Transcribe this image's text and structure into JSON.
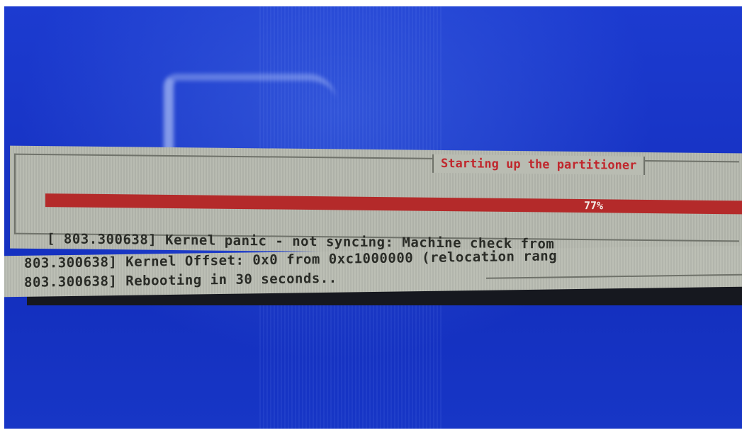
{
  "dialog": {
    "title": "Starting up the partitioner"
  },
  "progress": {
    "label": "77%",
    "value": 77
  },
  "console": {
    "lines": [
      "[   803.300638] Kernel panic - not syncing: Machine check from",
      "803.300638] Kernel Offset: 0x0 from 0xc1000000 (relocation rang",
      "803.300638] Rebooting in 30 seconds.."
    ]
  },
  "colors": {
    "screen_background": "#1733c4",
    "dialog_background": "#b9bcb2",
    "title_text": "#c0272d",
    "progress_fill": "#b42a2a"
  }
}
